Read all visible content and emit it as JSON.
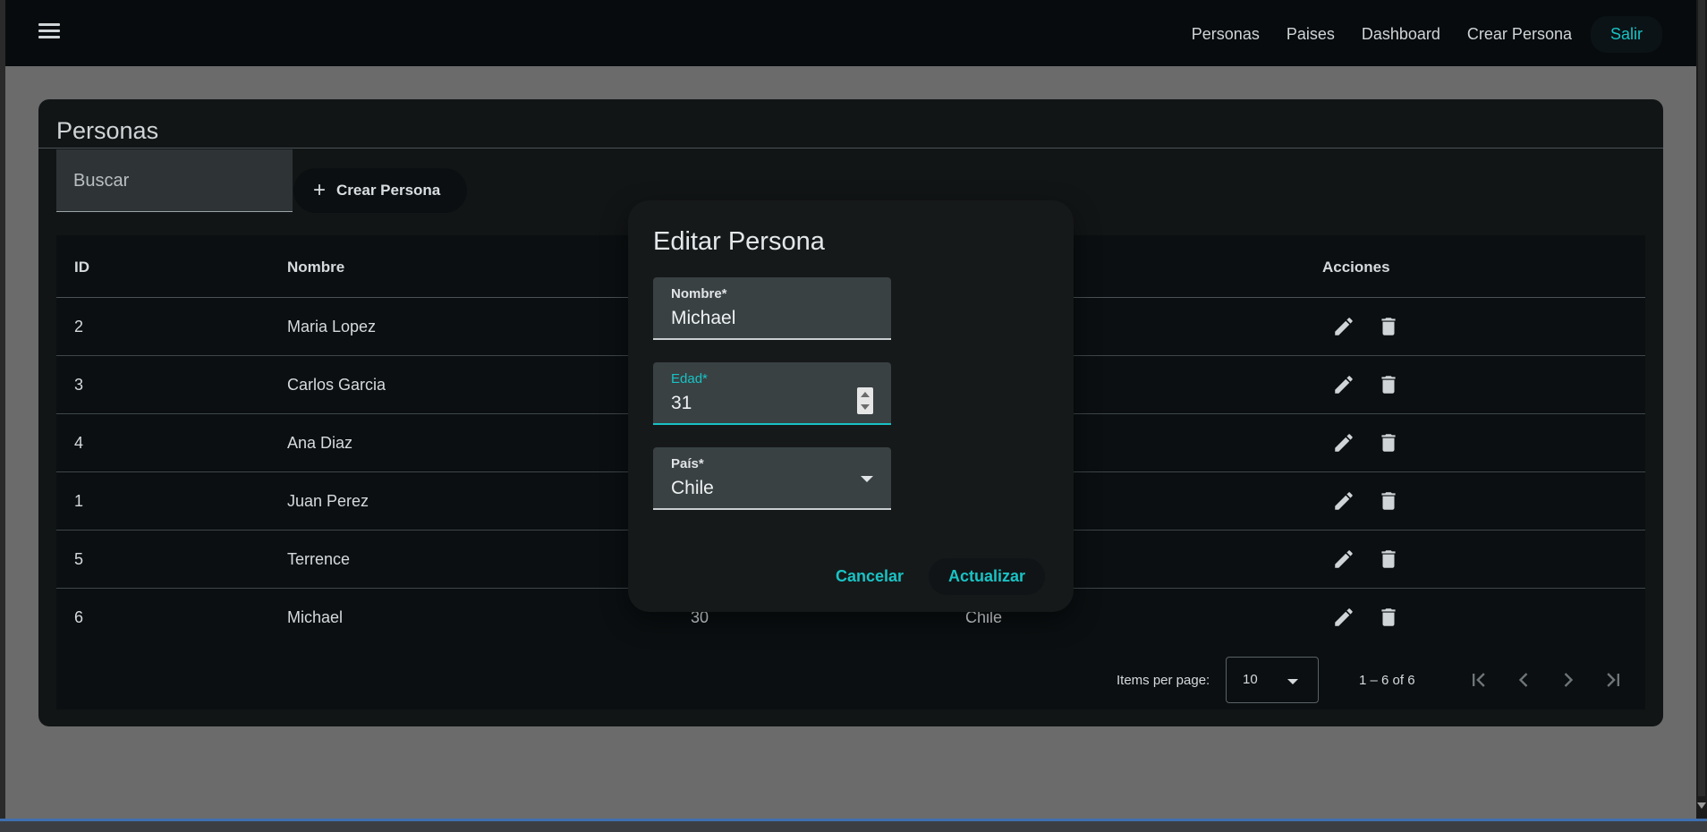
{
  "nav": {
    "items": [
      "Personas",
      "Paises",
      "Dashboard",
      "Crear Persona"
    ],
    "logout": "Salir"
  },
  "card": {
    "title": "Personas",
    "search_placeholder": "Buscar",
    "create_label": "Crear Persona"
  },
  "table": {
    "headers": {
      "id": "ID",
      "nombre": "Nombre",
      "acciones": "Acciones"
    },
    "rows": [
      {
        "id": "2",
        "nombre": "Maria Lopez",
        "edad": "",
        "pais": ""
      },
      {
        "id": "3",
        "nombre": "Carlos Garcia",
        "edad": "",
        "pais": ""
      },
      {
        "id": "4",
        "nombre": "Ana Diaz",
        "edad": "",
        "pais": ""
      },
      {
        "id": "1",
        "nombre": "Juan Perez",
        "edad": "",
        "pais": ""
      },
      {
        "id": "5",
        "nombre": "Terrence",
        "edad": "",
        "pais": ""
      },
      {
        "id": "6",
        "nombre": "Michael",
        "edad": "30",
        "pais": "Chile"
      }
    ]
  },
  "paginator": {
    "items_per_page_label": "Items per page:",
    "items_per_page_value": "10",
    "range": "1 – 6 of 6"
  },
  "dialog": {
    "title": "Editar Persona",
    "nombre_label": "Nombre*",
    "nombre_value": "Michael",
    "edad_label": "Edad*",
    "edad_value": "31",
    "pais_label": "País*",
    "pais_value": "Chile",
    "cancel_label": "Cancelar",
    "update_label": "Actualizar"
  },
  "colors": {
    "accent": "#19c2c4",
    "topbar": "#070b0d",
    "card": "#121516",
    "backdrop": "#6b6b6b"
  }
}
